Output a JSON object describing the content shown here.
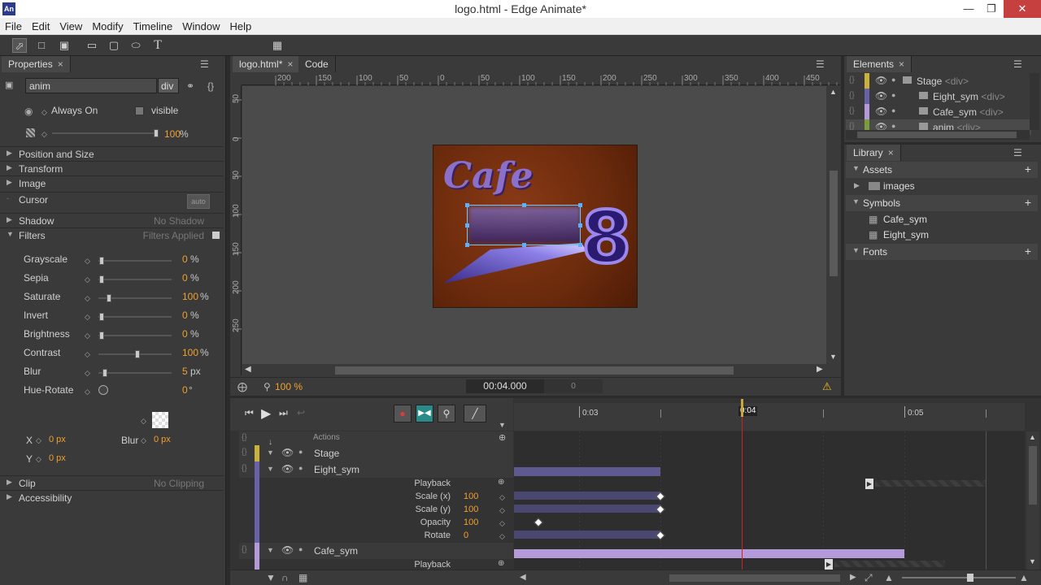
{
  "window": {
    "title": "logo.html - Edge Animate*",
    "app_icon": "An"
  },
  "menu": [
    "File",
    "Edit",
    "View",
    "Modify",
    "Timeline",
    "Window",
    "Help"
  ],
  "properties": {
    "tab": "Properties",
    "element_name": "anim",
    "element_tag": "div",
    "overflow": "Always On",
    "visibility": "visible",
    "opacity_value": "100",
    "opacity_unit": "%",
    "sections": {
      "position_size": "Position and Size",
      "transform": "Transform",
      "image": "Image",
      "cursor": "Cursor",
      "cursor_value": "auto",
      "shadow": "Shadow",
      "shadow_value": "No Shadow",
      "filters": "Filters",
      "filters_value": "Filters Applied",
      "clip": "Clip",
      "clip_value": "No Clipping",
      "accessibility": "Accessibility"
    },
    "filters": [
      {
        "label": "Grayscale",
        "value": "0",
        "unit": "%",
        "level": 0
      },
      {
        "label": "Sepia",
        "value": "0",
        "unit": "%",
        "level": 0
      },
      {
        "label": "Saturate",
        "value": "100",
        "unit": "%",
        "level": 0.1
      },
      {
        "label": "Invert",
        "value": "0",
        "unit": "%",
        "level": 0
      },
      {
        "label": "Brightness",
        "value": "0",
        "unit": "%",
        "level": 0
      },
      {
        "label": "Contrast",
        "value": "100",
        "unit": "%",
        "level": 0.5
      },
      {
        "label": "Blur",
        "value": "5",
        "unit": "px",
        "level": 0.05
      },
      {
        "label": "Hue-Rotate",
        "value": "0",
        "unit": "°",
        "level": 0
      }
    ],
    "shadow_x_label": "X",
    "shadow_x": "0 px",
    "shadow_blur_label": "Blur",
    "shadow_blur": "0 px",
    "shadow_y_label": "Y",
    "shadow_y": "0 px"
  },
  "doc": {
    "tabs": [
      "logo.html*",
      "Code"
    ],
    "ruler_top": [
      "200",
      "150",
      "100",
      "50",
      "0",
      "50",
      "100",
      "150",
      "200",
      "250",
      "300",
      "350",
      "400",
      "450"
    ],
    "ruler_left": [
      "50",
      "0",
      "50",
      "100",
      "150",
      "200",
      "250"
    ],
    "zoom": "100 %",
    "time": "00:04.000",
    "time_field": "0",
    "logo_text": "Cafe",
    "logo_number": "8"
  },
  "elements": {
    "tab": "Elements",
    "items": [
      {
        "name": "Stage",
        "tag": "<div>",
        "color": "#c9b13a"
      },
      {
        "name": "Eight_sym",
        "tag": "<div>",
        "color": "#6a62a8"
      },
      {
        "name": "Cafe_sym",
        "tag": "<div>",
        "color": "#b49ad8"
      },
      {
        "name": "anim",
        "tag": "<div>",
        "color": "#7a9c3a"
      }
    ]
  },
  "library": {
    "tab": "Library",
    "assets": "Assets",
    "images": "images",
    "symbols": "Symbols",
    "symbol_items": [
      "Cafe_sym",
      "Eight_sym"
    ],
    "fonts": "Fonts"
  },
  "timeline": {
    "times": [
      "0:03",
      "0:04",
      "0:05"
    ],
    "actions": "Actions",
    "rows": {
      "stage": "Stage",
      "eight": "Eight_sym",
      "cafe": "Cafe_sym"
    },
    "props": [
      {
        "label": "Playback",
        "value": ""
      },
      {
        "label": "Scale (x)",
        "value": "100"
      },
      {
        "label": "Scale (y)",
        "value": "100"
      },
      {
        "label": "Opacity",
        "value": "100"
      },
      {
        "label": "Rotate",
        "value": "0"
      }
    ],
    "cafe_playback": "Playback"
  }
}
